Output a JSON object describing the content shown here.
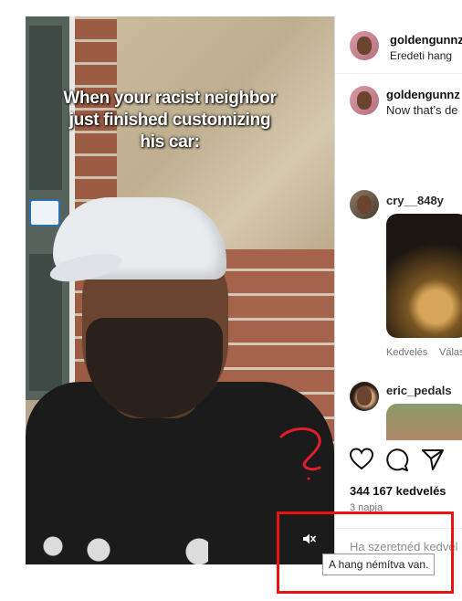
{
  "video": {
    "caption": "When your racist neighbor just finished customizing his car:"
  },
  "panel": {
    "owner": {
      "username": "goldengunnz",
      "audio": "Eredeti hang"
    },
    "caption_comment": {
      "username": "goldengunnz",
      "text": "Now that’s de"
    },
    "comments": [
      {
        "username": "cry__848y",
        "likes_label": "Kedvelés",
        "reply_label": "Válas"
      },
      {
        "username": "eric_pedals"
      }
    ],
    "actions": {
      "like_icon": "heart-icon",
      "comment_icon": "comment-icon",
      "share_icon": "send-icon"
    },
    "likes": "344 167 kedvelés",
    "time": "3 napja",
    "add_comment_placeholder": "Ha szeretnéd kedvel"
  },
  "tooltip": {
    "text": "A hang némítva van."
  },
  "colors": {
    "highlight": "#ee1111",
    "annotation": "#e11d2a"
  }
}
